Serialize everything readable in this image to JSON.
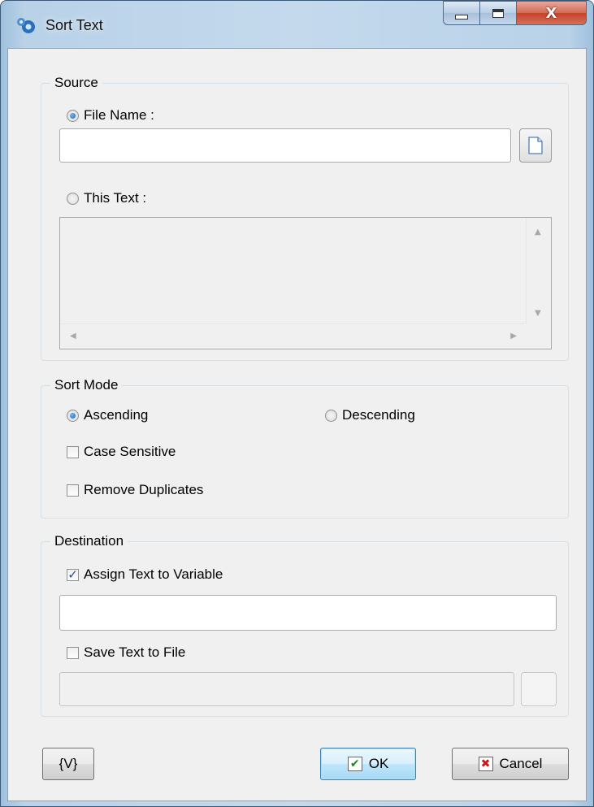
{
  "window": {
    "title": "Sort Text",
    "minimize_icon": "minimize-icon",
    "maximize_icon": "maximize-icon",
    "close_icon": "close-icon",
    "close_glyph": "X"
  },
  "source": {
    "legend": "Source",
    "file_name_label": "File Name :",
    "file_name_selected": true,
    "file_name_value": "",
    "this_text_label": "This Text :",
    "this_text_selected": false,
    "this_text_value": ""
  },
  "sort_mode": {
    "legend": "Sort Mode",
    "ascending_label": "Ascending",
    "ascending_selected": true,
    "descending_label": "Descending",
    "descending_selected": false,
    "case_sensitive_label": "Case Sensitive",
    "case_sensitive_checked": false,
    "remove_duplicates_label": "Remove Duplicates",
    "remove_duplicates_checked": false
  },
  "destination": {
    "legend": "Destination",
    "assign_variable_label": "Assign Text to Variable",
    "assign_variable_checked": true,
    "variable_value": "",
    "save_file_label": "Save Text to File",
    "save_file_checked": false,
    "file_path_value": ""
  },
  "footer": {
    "variables_label": "{V}",
    "ok_label": "OK",
    "cancel_label": "Cancel",
    "check_glyph": "✔",
    "x_glyph": "✖"
  }
}
